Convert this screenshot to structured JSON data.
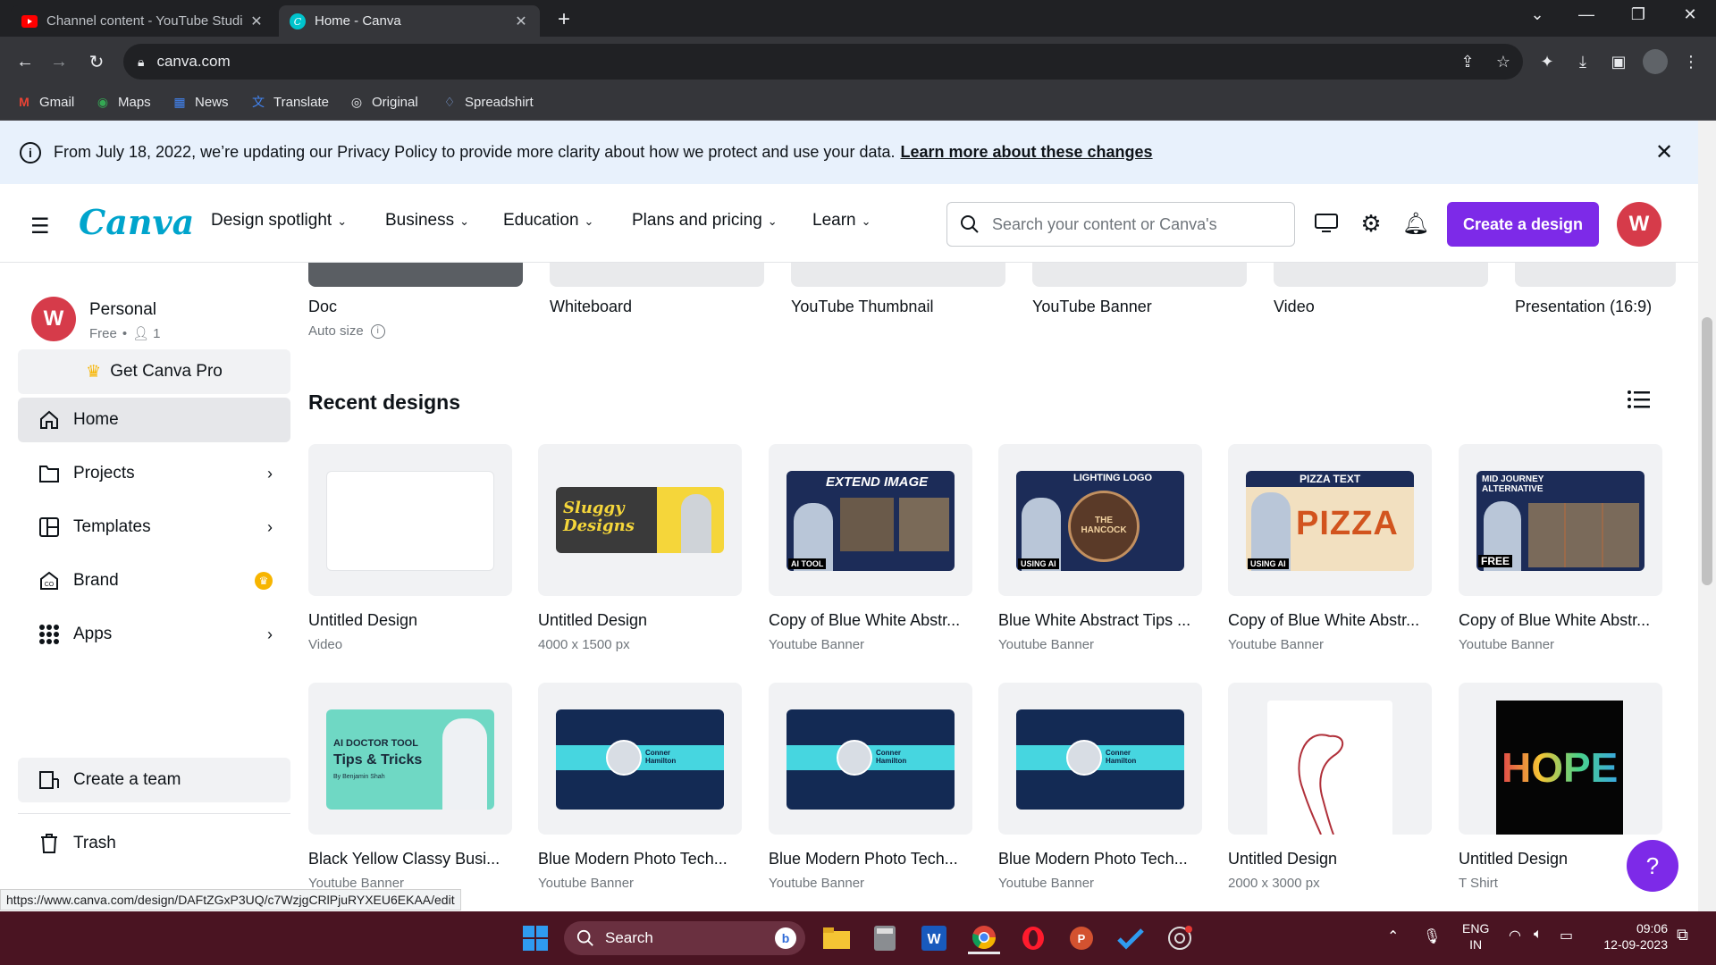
{
  "browser": {
    "tabs": [
      {
        "title": "Channel content - YouTube Studi",
        "active": false
      },
      {
        "title": "Home - Canva",
        "active": true
      }
    ],
    "url": "canva.com",
    "bookmarks": [
      "Gmail",
      "Maps",
      "News",
      "Translate",
      "Original",
      "Spreadshirt"
    ],
    "status_url": "https://www.canva.com/design/DAFtZGxP3UQ/c7WzjgCRlPjuRYXEU6EKAA/edit"
  },
  "banner": {
    "text": "From July 18, 2022, we’re updating our Privacy Policy to provide more clarity about how we protect and use your data.",
    "link": "Learn more about these changes"
  },
  "header": {
    "logo": "Canva",
    "nav": [
      "Design spotlight",
      "Business",
      "Education",
      "Plans and pricing",
      "Learn"
    ],
    "search_placeholder": "Search your content or Canva's",
    "create_button": "Create a design",
    "avatar_letter": "W"
  },
  "sidebar": {
    "account_name": "Personal",
    "account_plan": "Free",
    "account_members": "1",
    "avatar_letter": "W",
    "pro_button": "Get Canva Pro",
    "items": [
      {
        "label": "Home",
        "icon": "home-icon"
      },
      {
        "label": "Projects",
        "icon": "folder-icon"
      },
      {
        "label": "Templates",
        "icon": "templates-icon"
      },
      {
        "label": "Brand",
        "icon": "brand-icon"
      },
      {
        "label": "Apps",
        "icon": "apps-icon"
      }
    ],
    "create_team": "Create a team",
    "trash": "Trash"
  },
  "design_types": [
    {
      "label": "Doc",
      "sub": "Auto size"
    },
    {
      "label": "Whiteboard"
    },
    {
      "label": "YouTube Thumbnail"
    },
    {
      "label": "YouTube Banner"
    },
    {
      "label": "Video"
    },
    {
      "label": "Presentation (16:9)"
    }
  ],
  "recent": {
    "title": "Recent designs",
    "designs": [
      {
        "title": "Untitled Design",
        "sub": "Video"
      },
      {
        "title": "Untitled Design",
        "sub": "4000 x 1500 px"
      },
      {
        "title": "Copy of Blue White Abstr...",
        "sub": "Youtube Banner"
      },
      {
        "title": "Blue White Abstract Tips ...",
        "sub": "Youtube Banner"
      },
      {
        "title": "Copy of Blue White Abstr...",
        "sub": "Youtube Banner"
      },
      {
        "title": "Copy of Blue White Abstr...",
        "sub": "Youtube Banner"
      },
      {
        "title": "Black Yellow Classy Busi...",
        "sub": "Youtube Banner"
      },
      {
        "title": "Blue Modern Photo Tech...",
        "sub": "Youtube Banner"
      },
      {
        "title": "Blue Modern Photo Tech...",
        "sub": "Youtube Banner"
      },
      {
        "title": "Blue Modern Photo Tech...",
        "sub": "Youtube Banner"
      },
      {
        "title": "Untitled Design",
        "sub": "2000 x 3000 px"
      },
      {
        "title": "Untitled Design",
        "sub": "T Shirt"
      }
    ],
    "thumb_texts": {
      "sluggy": "Sluggy Designs",
      "extend": "EXTEND IMAGE",
      "ai_tool": "AI TOOL",
      "lighting": "LIGHTING LOGO",
      "hancock": "THE HANCOCK",
      "using_ai": "USING AI",
      "pizza_hdr": "PIZZA TEXT",
      "pizza": "PIZZA",
      "midjourney": "MID JOURNEY ALTERNATIVE",
      "free": "FREE",
      "ai_doctor": "AI DOCTOR TOOL",
      "tips": "Tips & Tricks",
      "by": "By Benjamin Shah",
      "conner": "Conner Hamilton",
      "hope": "HOPE"
    }
  },
  "taskbar": {
    "search": "Search",
    "lang1": "ENG",
    "lang2": "IN",
    "time": "09:06",
    "date": "12-09-2023"
  },
  "colors": {
    "accent": "#7d2ae8",
    "avatar": "#d63b4a",
    "banner_bg": "#e8f1fc",
    "taskbar": "#4a1422"
  }
}
